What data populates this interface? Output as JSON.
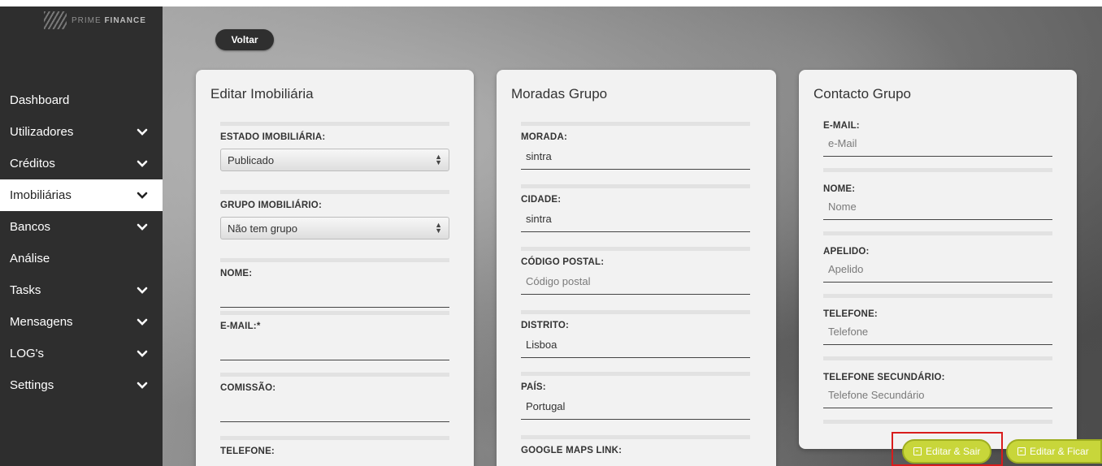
{
  "brand": {
    "logo_light": "PRIME",
    "logo_bold": "FINANCE"
  },
  "sidebar": {
    "items": [
      {
        "label": "Dashboard",
        "chevron": false,
        "active": false
      },
      {
        "label": "Utilizadores",
        "chevron": true,
        "active": false
      },
      {
        "label": "Créditos",
        "chevron": true,
        "active": false
      },
      {
        "label": "Imobiliárias",
        "chevron": true,
        "active": true
      },
      {
        "label": "Bancos",
        "chevron": true,
        "active": false
      },
      {
        "label": "Análise",
        "chevron": false,
        "active": false
      },
      {
        "label": "Tasks",
        "chevron": true,
        "active": false
      },
      {
        "label": "Mensagens",
        "chevron": true,
        "active": false
      },
      {
        "label": "LOG's",
        "chevron": true,
        "active": false
      },
      {
        "label": "Settings",
        "chevron": true,
        "active": false
      }
    ]
  },
  "back_label": "Voltar",
  "card_edit": {
    "title": "Editar Imobiliária",
    "estado_label": "ESTADO IMOBILIÁRIA:",
    "estado_value": "Publicado",
    "grupo_label": "GRUPO IMOBILIÁRIO:",
    "grupo_value": "Não tem grupo",
    "nome_label": "NOME:",
    "nome_value": "",
    "email_label": "E-MAIL:*",
    "email_value": "",
    "comissao_label": "COMISSÃO:",
    "comissao_value": "",
    "telefone_label": "TELEFONE:"
  },
  "card_moradas": {
    "title": "Moradas Grupo",
    "morada_label": "MORADA:",
    "morada_value": "sintra",
    "cidade_label": "CIDADE:",
    "cidade_value": "sintra",
    "codigo_label": "CÓDIGO POSTAL:",
    "codigo_placeholder": "Código postal",
    "distrito_label": "DISTRITO:",
    "distrito_value": "Lisboa",
    "pais_label": "PAÍS:",
    "pais_value": "Portugal",
    "maps_label": "GOOGLE MAPS LINK:"
  },
  "card_contacto": {
    "title": "Contacto Grupo",
    "email_label": "E-MAIL:",
    "email_placeholder": "e-Mail",
    "nome_label": "NOME:",
    "nome_placeholder": "Nome",
    "apelido_label": "APELIDO:",
    "apelido_placeholder": "Apelido",
    "telefone_label": "TELEFONE:",
    "telefone_placeholder": "Telefone",
    "telefone2_label": "TELEFONE SECUNDÁRIO:",
    "telefone2_placeholder": "Telefone Secundário"
  },
  "actions": {
    "save_exit": "Editar & Sair",
    "save_stay": "Editar & Ficar"
  },
  "colors": {
    "accent": "#c8d63a",
    "highlight": "#d81c1c",
    "sidebar": "#2e2e2e"
  }
}
